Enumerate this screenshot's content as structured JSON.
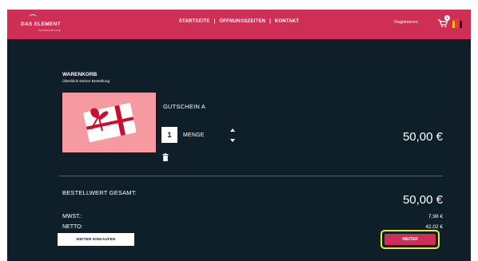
{
  "header": {
    "logo_text": "DAS ELEMENT",
    "logo_sub": "NATURCLUB CLUB",
    "nav": [
      "STARTSEITE",
      "ÖFFNUNGSZEITEN",
      "KONTAKT"
    ],
    "nav_separator": "|",
    "register": "Registrieren",
    "cart_count": "1",
    "icons": {
      "cart": "cart-icon",
      "flag": "german-flag-icon"
    },
    "accent_color": "#cf2e55"
  },
  "cart": {
    "title": "WARENKORB",
    "subtitle": "Überblick Deiner Bestellung",
    "item": {
      "name": "GUTSCHEIN A",
      "quantity": "1",
      "quantity_label": "MENGE",
      "price": "50,00 €",
      "image_icon": "gift-card-image",
      "delete_icon": "trash-icon"
    },
    "summary": {
      "total_label": "BESTELLWERT GESAMT:",
      "total_value": "50,00 €",
      "vat_label": "MWST.:",
      "vat_value": "7,98 €",
      "net_label": "NETTO:",
      "net_value": "42,02 €"
    },
    "buttons": {
      "continue_shopping": "WEITER EINKAUFEN",
      "next": "WEITER"
    }
  },
  "colors": {
    "background": "#0f1f29",
    "highlight": "#e5eb3d"
  }
}
